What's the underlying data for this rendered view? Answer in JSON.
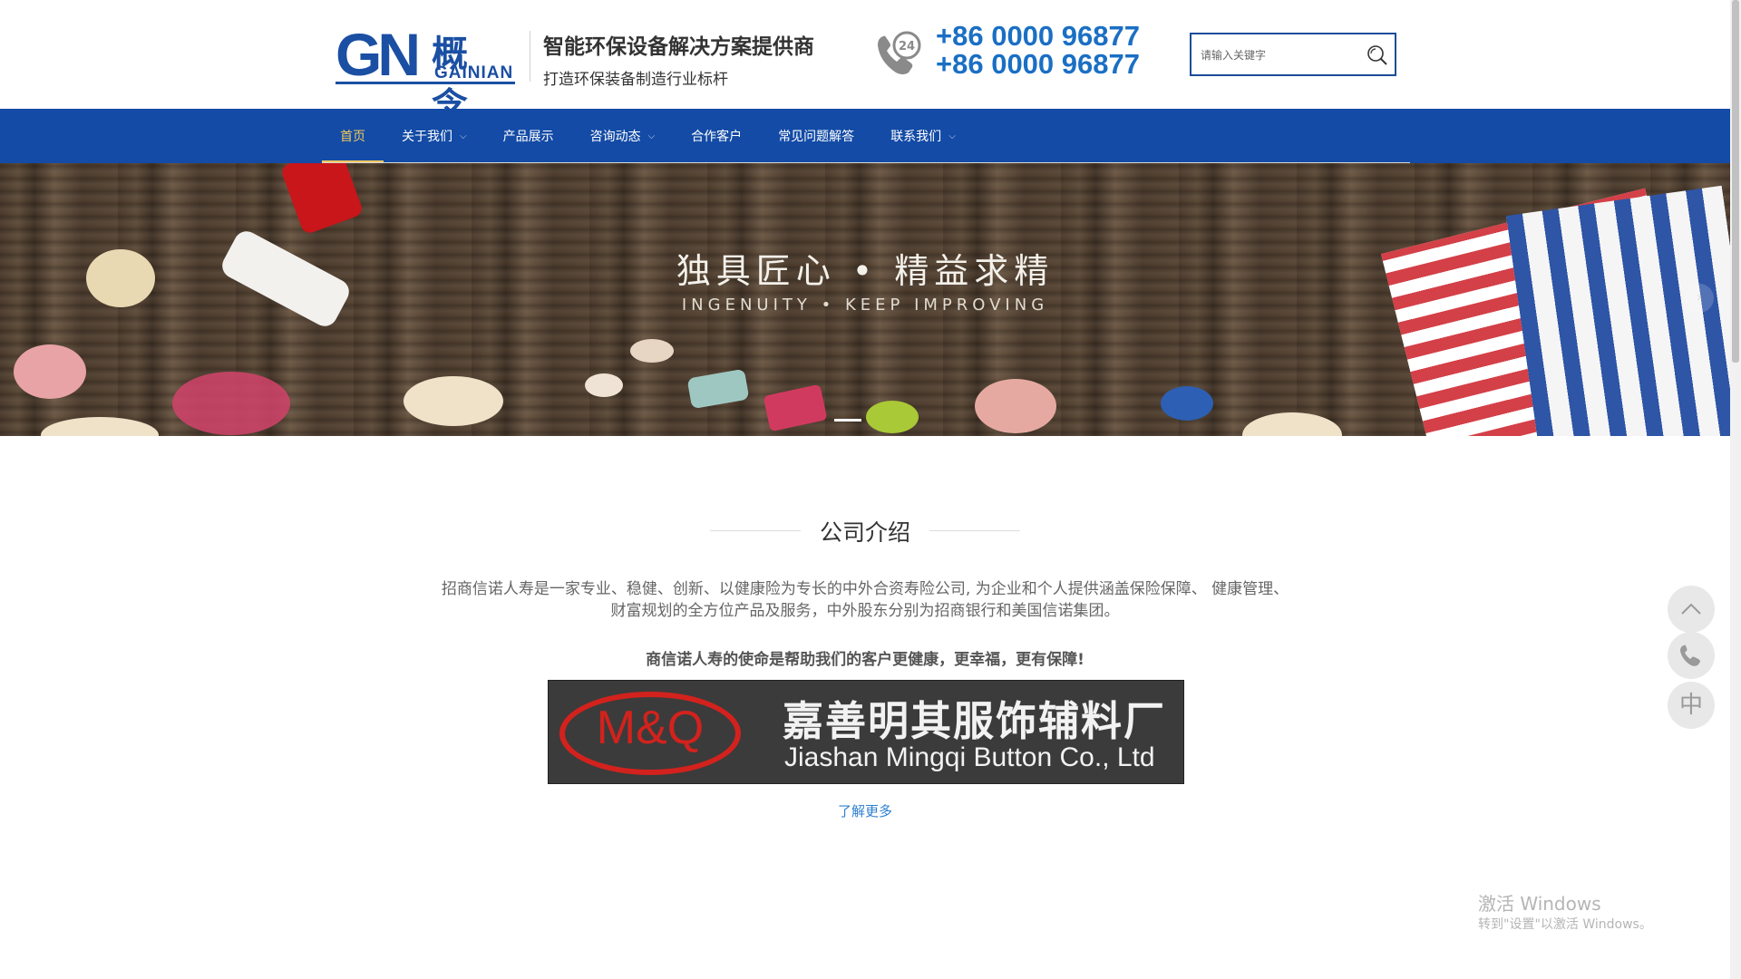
{
  "header": {
    "logo_gn": "GN",
    "logo_cn": "概念",
    "logo_en": "GAINIAN",
    "slogan_main": "智能环保设备解决方案提供商",
    "slogan_sub": "打造环保装备制造行业标杆",
    "phone_icon_text": "24",
    "phone_1": "+86 0000 96877",
    "phone_2": "+86 0000 96877",
    "search_placeholder": "请输入关键字"
  },
  "nav": {
    "items": [
      {
        "label": "首页",
        "active": true,
        "dropdown": false
      },
      {
        "label": "关于我们",
        "active": false,
        "dropdown": true
      },
      {
        "label": "产品展示",
        "active": false,
        "dropdown": false
      },
      {
        "label": "咨询动态",
        "active": false,
        "dropdown": true
      },
      {
        "label": "合作客户",
        "active": false,
        "dropdown": false
      },
      {
        "label": "常见问题解答",
        "active": false,
        "dropdown": false
      },
      {
        "label": "联系我们",
        "active": false,
        "dropdown": true
      }
    ]
  },
  "banner": {
    "headline": "独具匠心 • 精益求精",
    "subline": "INGENUITY • KEEP IMPROVING",
    "next_label": "›"
  },
  "about": {
    "title": "公司介绍",
    "description_line1": "招商信诺人寿是一家专业、稳健、创新、以健康险为专长的中外合资寿险公司, 为企业和个人提供涵盖保险保障、 健康管理、",
    "description_line2": "财富规划的全方位产品及服务，中外股东分别为招商银行和美国信诺集团。",
    "mission": "商信诺人寿的使命是帮助我们的客户更健康，更幸福，更有保障!",
    "image_logo_text": "M&Q",
    "image_cn": "嘉善明其服饰辅料厂",
    "image_en": "Jiashan Mingqi Button Co., Ltd",
    "more_link": "了解更多"
  },
  "side": {
    "top_label": "︿",
    "lang_label": "中"
  },
  "watermark": {
    "line1": "激活 Windows",
    "line2": "转到\"设置\"以激活 Windows。"
  },
  "colors": {
    "brand_blue": "#1a4fa3",
    "nav_blue": "#134ba6",
    "active_gold": "#f1c95e",
    "phone_blue": "#1a6fc4",
    "link_blue": "#2f7fd0"
  }
}
